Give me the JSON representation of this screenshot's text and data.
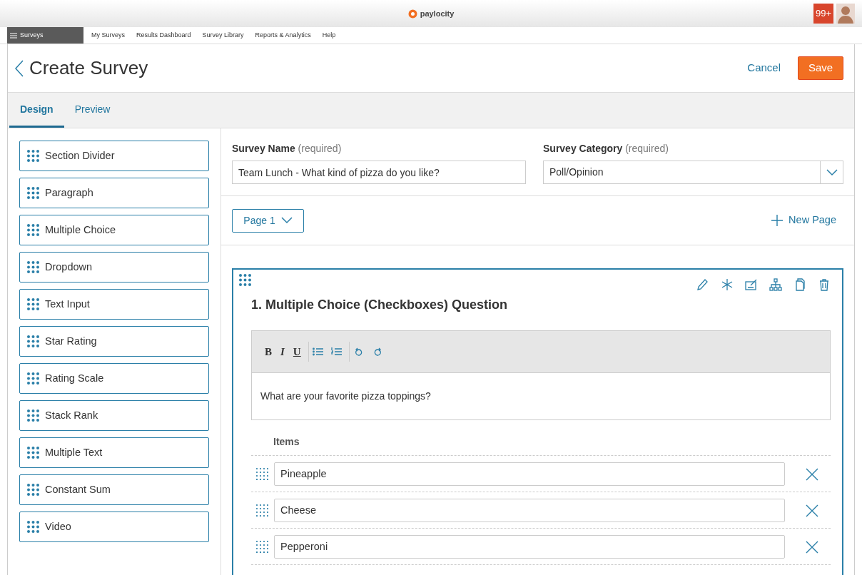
{
  "app_header": {
    "logo": "paylocity",
    "notification_count": "99+"
  },
  "nav": {
    "menu_label": "Surveys",
    "links": [
      "My Surveys",
      "Results Dashboard",
      "Survey Library",
      "Reports & Analytics",
      "Help"
    ]
  },
  "page": {
    "title": "Create Survey",
    "cancel": "Cancel",
    "save": "Save"
  },
  "tabs": [
    {
      "label": "Design",
      "selected": true
    },
    {
      "label": "Preview",
      "selected": false
    }
  ],
  "palette": [
    "Section Divider",
    "Paragraph",
    "Multiple Choice",
    "Dropdown",
    "Text Input",
    "Star Rating",
    "Rating Scale",
    "Stack Rank",
    "Multiple Text",
    "Constant Sum",
    "Video"
  ],
  "survey_name": {
    "label": "**Survey Name** (required)",
    "value": "Team Lunch - What kind of pizza do you like?"
  },
  "survey_category": {
    "label": "**Survey Category** (required)",
    "value": "Poll/Opinion"
  },
  "page_selector": "Page 1",
  "new_page": "New Page",
  "question": {
    "title": "1. Multiple Choice (Checkboxes) Question",
    "format_buttons": [
      "B",
      "I",
      "U"
    ],
    "prompt": "What are your favorite pizza toppings?",
    "items_label": "Items",
    "items": [
      "Pineapple",
      "Cheese",
      "Pepperoni"
    ]
  }
}
